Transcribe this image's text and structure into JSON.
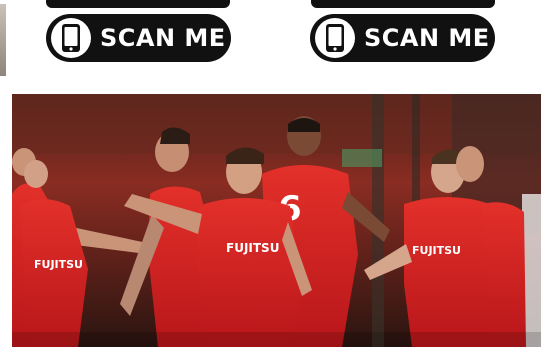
{
  "scan_buttons": [
    {
      "label": "SCAN ME",
      "icon": "smartphone-icon"
    },
    {
      "label": "SCAN ME",
      "icon": "smartphone-icon"
    }
  ],
  "photo": {
    "jersey_sponsor": "FUJITSU",
    "shirt_number": "6",
    "colors": {
      "kit_red": "#d8201f",
      "background_dark": "#2a1410",
      "button_black": "#111111"
    }
  }
}
